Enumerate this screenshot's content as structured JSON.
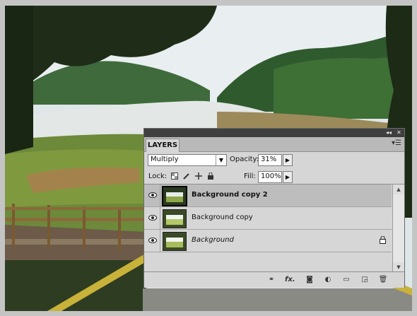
{
  "panel": {
    "tab_label": "LAYERS",
    "collapse_glyph": "◂◂",
    "close_glyph": "✕",
    "menu_glyph": "▾☰",
    "blend_mode": "Multiply",
    "blend_arrow": "▼",
    "opacity_label": "Opacity:",
    "opacity_value": "31%",
    "lock_label": "Lock:",
    "fill_label": "Fill:",
    "fill_value": "100%",
    "step_glyph": "▶"
  },
  "layers": [
    {
      "name": "Background copy 2",
      "selected": true,
      "visible": true,
      "locked": false,
      "style": "bold"
    },
    {
      "name": "Background copy",
      "selected": false,
      "visible": true,
      "locked": false,
      "style": "normal"
    },
    {
      "name": "Background",
      "selected": false,
      "visible": true,
      "locked": true,
      "style": "italic"
    }
  ],
  "lock_icons": [
    "lock-transparent-icon",
    "lock-image-icon",
    "lock-position-icon",
    "lock-all-icon"
  ],
  "bottom_icons": [
    {
      "name": "link-layers-icon",
      "glyph": "⚭"
    },
    {
      "name": "layer-style-icon",
      "glyph": "fx."
    },
    {
      "name": "add-mask-icon",
      "glyph": "◙"
    },
    {
      "name": "adjustment-layer-icon",
      "glyph": "◐"
    },
    {
      "name": "new-group-icon",
      "glyph": "▭"
    },
    {
      "name": "new-layer-icon",
      "glyph": "◲"
    },
    {
      "name": "delete-layer-icon",
      "glyph": "🗑"
    }
  ],
  "scrollbar": {
    "up": "▲",
    "down": "▼"
  }
}
